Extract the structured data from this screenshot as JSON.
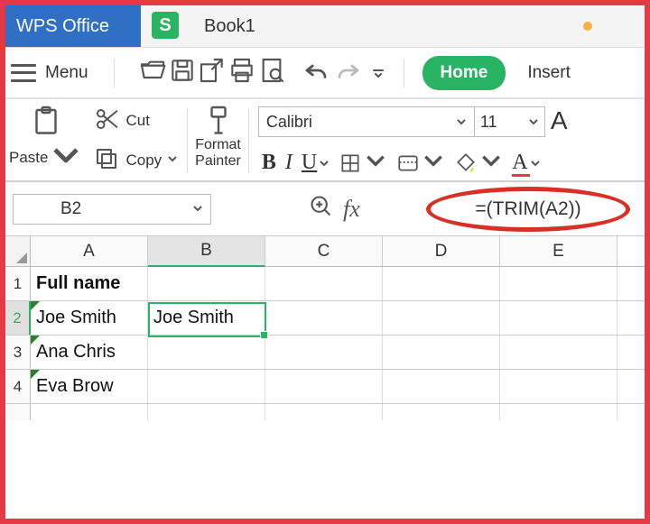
{
  "titlebar": {
    "app_name": "WPS Office",
    "tab_icon_letter": "S",
    "tab_label": "Book1"
  },
  "ribbon": {
    "menu_label": "Menu",
    "tabs": {
      "home": "Home",
      "insert": "Insert"
    },
    "clipboard": {
      "paste_label": "Paste",
      "cut_label": "Cut",
      "copy_label": "Copy"
    },
    "format_painter": {
      "line1": "Format",
      "line2": "Painter"
    },
    "font": {
      "name": "Calibri",
      "size": "11",
      "bold": "B",
      "italic": "I",
      "underline": "U",
      "letter_a": "A"
    }
  },
  "address_bar": {
    "cell_ref": "B2",
    "fx_label": "fx",
    "formula": "=(TRIM(A2))"
  },
  "grid": {
    "columns": [
      "A",
      "B",
      "C",
      "D",
      "E"
    ],
    "active_col_index": 1,
    "rows": [
      {
        "num": "1",
        "cells": [
          "Full name",
          "",
          "",
          "",
          ""
        ],
        "bold_col0": true
      },
      {
        "num": "2",
        "cells": [
          "Joe Smith",
          "Joe Smith",
          "",
          "",
          ""
        ],
        "tri_col0": true,
        "active": true
      },
      {
        "num": "3",
        "cells": [
          "Ana Chris",
          "",
          "",
          "",
          ""
        ],
        "tri_col0": true
      },
      {
        "num": "4",
        "cells": [
          "Eva Brow",
          "",
          "",
          "",
          ""
        ],
        "tri_col0": true
      }
    ]
  }
}
